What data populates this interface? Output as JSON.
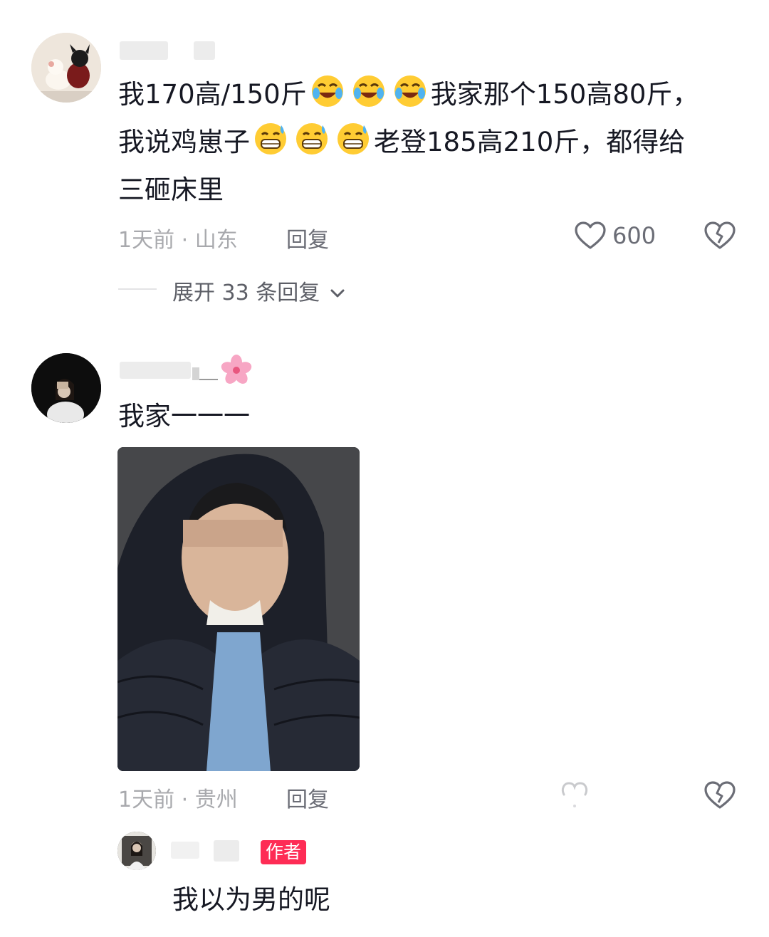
{
  "comments": [
    {
      "avatar_icon": "user-avatar",
      "text_lines": [
        "我170高/150斤",
        "我家那个150高80斤，",
        "我说鸡崽子",
        "老登185高210斤，都得给",
        "三砸床里"
      ],
      "emoji_groups": [
        "rolling-laughing-emoji",
        "grinning-sweat-emoji"
      ],
      "time": "1天前",
      "separator": "·",
      "location": "山东",
      "reply_label": "回复",
      "like_count": "600",
      "expand_label": "展开 33 条回复"
    },
    {
      "avatar_icon": "user-avatar",
      "name_emoji": "cherry-blossom-emoji",
      "text": "我家一一一",
      "image": "user-photo",
      "time": "1天前",
      "separator": "·",
      "location": "贵州",
      "reply_label": "回复"
    }
  ],
  "reply": {
    "badge": "作者",
    "text": "我以为男的呢"
  },
  "colors": {
    "badge": "#fe2c55",
    "meta": "#a8a9ad",
    "text": "#161823"
  }
}
